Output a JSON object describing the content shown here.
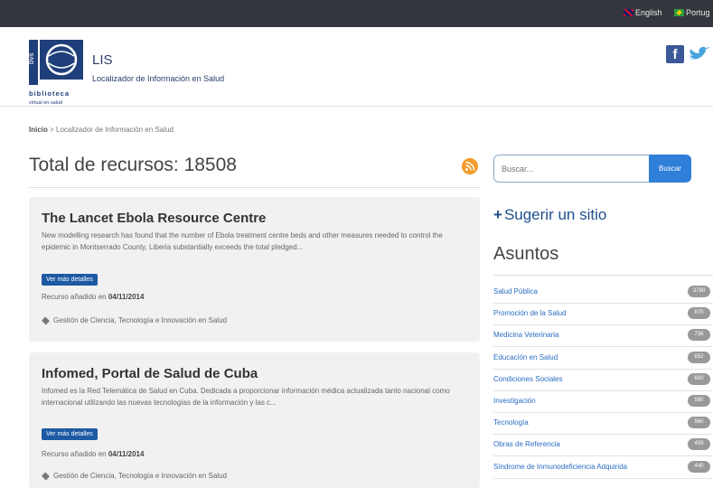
{
  "topbar": {
    "languages": [
      {
        "label": "English"
      },
      {
        "label": "Portug"
      }
    ]
  },
  "header": {
    "logo_text": "biblioteca virtual en salud",
    "title": "LIS",
    "subtitle": "Localizador de Información en Salud",
    "facebook_glyph": "f"
  },
  "breadcrumb": {
    "home": "Inicio",
    "separator": ">",
    "current": "Localizador de Información en Salud"
  },
  "results": {
    "total_label": "Total de recursos: 18508"
  },
  "resources": [
    {
      "title": "The Lancet Ebola Resource Centre",
      "description": "New modelling research has found that the number of Ebola treatment centre beds and other measures needed to control the epidemic in Montserrado County, Liberia substantially exceeds the total pledged...",
      "more_label": "Ver más detalles",
      "meta_prefix": "Recurso añadido en",
      "meta_date": "04/11/2014",
      "tag": "Gestión de Ciencia, Tecnología e Innovación en Salud"
    },
    {
      "title": "Infomed, Portal de Salud de Cuba",
      "description": "Infomed es la Red Telemática de Salud en Cuba. Dedicada a proporcionar información médica actualizada tanto nacional como internacional utilizando las nuevas tecnologías de la información y las c...",
      "more_label": "Ver más detalles",
      "meta_prefix": "Recurso añadido en",
      "meta_date": "04/11/2014",
      "tag": "Gestión de Ciencia, Tecnología e Innovación en Salud"
    }
  ],
  "search": {
    "placeholder": "Buscar...",
    "button_label": "Buscar"
  },
  "sidebar": {
    "suggest_plus": "+",
    "suggest_label": "Sugerir un sitio",
    "subjects_title": "Asuntos",
    "subjects": [
      {
        "label": "Salud Pública",
        "count": "3780"
      },
      {
        "label": "Promoción de la Salud",
        "count": "870"
      },
      {
        "label": "Medicina Veterinaria",
        "count": "736"
      },
      {
        "label": "Educación en Salud",
        "count": "652"
      },
      {
        "label": "Condiciones Sociales",
        "count": "600"
      },
      {
        "label": "Investigación",
        "count": "580"
      },
      {
        "label": "Tecnología",
        "count": "560"
      },
      {
        "label": "Obras de Referencia",
        "count": "459"
      },
      {
        "label": "Síndrome de Inmunodeficiencia Adquirida",
        "count": "440"
      }
    ]
  },
  "colors": {
    "topbar": "#33373d",
    "link_blue": "#2a6cc2",
    "button_blue": "#1d5aa3",
    "rss_orange": "#f39c2d",
    "card_bg": "#f1f1f1"
  },
  "icons": [
    "uk-flag-icon",
    "brazil-flag-icon",
    "facebook-icon",
    "twitter-icon",
    "rss-icon",
    "tag-icon"
  ]
}
